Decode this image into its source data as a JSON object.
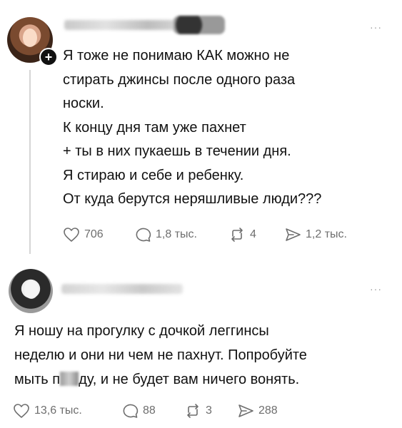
{
  "posts": [
    {
      "text_lines": [
        "Я тоже не понимаю КАК можно не",
        "стирать джинсы после одного раза",
        "носки.",
        "К концу дня там уже пахнет",
        "+ ты в них пукаешь в течении дня.",
        "Я стираю и себе и ребенку.",
        "От куда берутся неряшливые люди???"
      ],
      "actions": {
        "likes": "706",
        "replies": "1,8 тыс.",
        "reposts": "4",
        "shares": "1,2 тыс."
      },
      "more_label": "···"
    },
    {
      "text_lines": [
        "Я ношу на прогулку с дочкой леггинсы",
        "неделю и они ни чем не пахнут. Попробуйте",
        "мыть п",
        "ду, и не будет вам ничего вонять."
      ],
      "actions": {
        "likes": "13,6 тыс.",
        "replies": "88",
        "reposts": "3",
        "shares": "288"
      },
      "more_label": "···"
    }
  ],
  "follow_badge": "+",
  "icons": [
    "heart-icon",
    "comment-icon",
    "repost-icon",
    "share-icon",
    "more-icon"
  ],
  "colors": {
    "text": "#111111",
    "muted": "#6e6e6e",
    "thread_line": "#d6d6d6"
  }
}
